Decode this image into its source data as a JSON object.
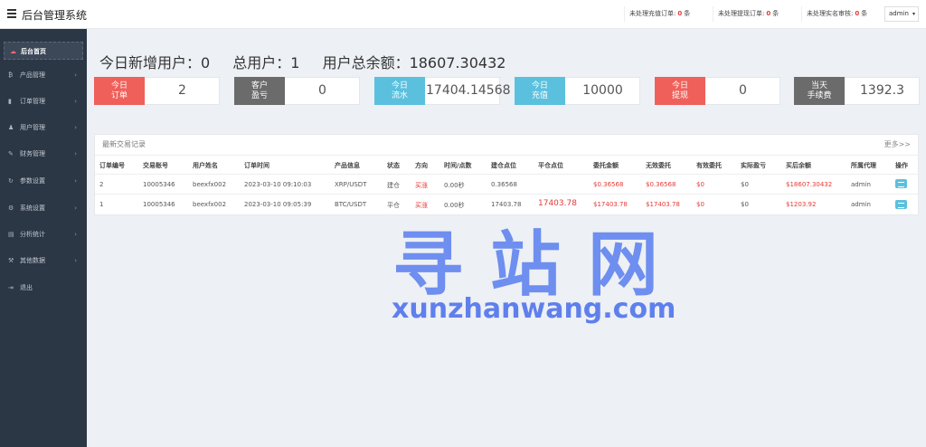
{
  "header": {
    "title": "后台管理系统",
    "pending": [
      {
        "label": "未处理充值订单:",
        "count": "0",
        "suffix": "条"
      },
      {
        "label": "未处理提现订单:",
        "count": "0",
        "suffix": "条"
      },
      {
        "label": "未处理实名审核:",
        "count": "0",
        "suffix": "条"
      }
    ],
    "user": "admin"
  },
  "sidebar": {
    "items": [
      {
        "label": "后台首页",
        "icon": "home-icon"
      },
      {
        "label": "产品管理",
        "icon": "product-icon"
      },
      {
        "label": "订单管理",
        "icon": "order-icon"
      },
      {
        "label": "用户管理",
        "icon": "user-icon"
      },
      {
        "label": "财务管理",
        "icon": "finance-icon"
      },
      {
        "label": "参数设置",
        "icon": "params-icon"
      },
      {
        "label": "系统设置",
        "icon": "system-icon"
      },
      {
        "label": "分析统计",
        "icon": "stats-icon"
      },
      {
        "label": "其他数据",
        "icon": "other-data-icon"
      },
      {
        "label": "退出",
        "icon": "logout-icon"
      }
    ]
  },
  "summary": {
    "new_users": "今日新增用户：0",
    "total_users": "总用户：1",
    "total_balance": "用户总余额：18607.30432"
  },
  "cards": [
    {
      "line1": "今日",
      "line2": "订单",
      "value": "2",
      "color": "#f0605a"
    },
    {
      "line1": "客户",
      "line2": "盈亏",
      "value": "0",
      "color": "#6b6b6b"
    },
    {
      "line1": "今日",
      "line2": "流水",
      "value": "17404.14568",
      "color": "#5bc0de"
    },
    {
      "line1": "今日",
      "line2": "充值",
      "value": "10000",
      "color": "#5bc0de"
    },
    {
      "line1": "今日",
      "line2": "提现",
      "value": "0",
      "color": "#f0605a"
    },
    {
      "line1": "当天",
      "line2": "手续费",
      "value": "1392.3",
      "color": "#6b6b6b"
    }
  ],
  "table": {
    "title": "最新交易记录",
    "more": "更多>>",
    "headers": [
      "订单编号",
      "交易账号",
      "用户姓名",
      "订单时间",
      "产品信息",
      "状态",
      "方向",
      "时间/点数",
      "建仓点位",
      "平仓点位",
      "委托金额",
      "无效委托",
      "有效委托",
      "实际盈亏",
      "买后余额",
      "所属代理",
      "操作"
    ],
    "rows": [
      [
        "2",
        "10005346",
        "beexfx002",
        "2023-03-10 09:10:03",
        "XRP/USDT",
        "建仓",
        "买涨",
        "0.00秒",
        "0.36568",
        "",
        "$0.36568",
        "$0.36568",
        "$0",
        "$0",
        "$18607.30432",
        "admin"
      ],
      [
        "1",
        "10005346",
        "beexfx002",
        "2023-03-10 09:05:39",
        "BTC/USDT",
        "平仓",
        "买涨",
        "0.00秒",
        "17403.78",
        "17403.78",
        "$17403.78",
        "$17403.78",
        "$0",
        "$0",
        "$1203.92",
        "admin"
      ]
    ]
  },
  "watermark": {
    "text": "寻站网",
    "url": "xunzhanwang.com"
  }
}
